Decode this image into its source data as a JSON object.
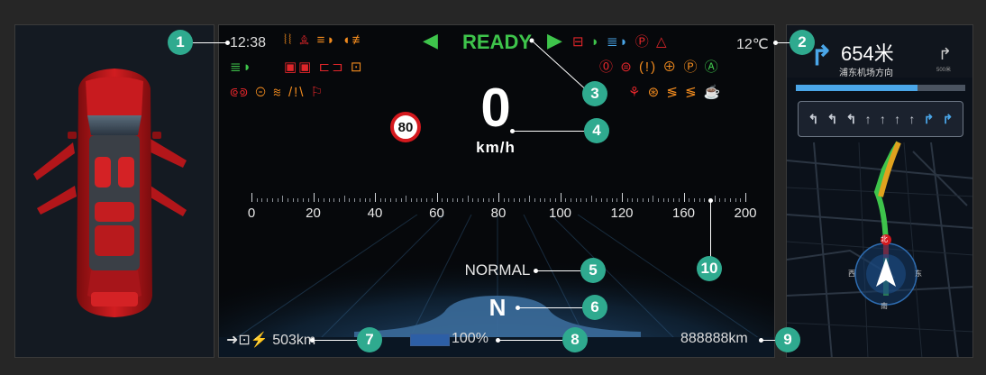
{
  "status_bar": {
    "time": "12:38",
    "ready": "READY",
    "temperature": "12℃"
  },
  "speed": {
    "value": "0",
    "unit": "km/h",
    "limit": "80",
    "scale": [
      "0",
      "20",
      "40",
      "60",
      "80",
      "100",
      "120",
      "160",
      "200"
    ]
  },
  "drive": {
    "mode": "NORMAL",
    "gear": "N"
  },
  "bottom": {
    "range": "503km",
    "battery": "100%",
    "battery_level": 1.0,
    "odometer": "888888km"
  },
  "navigation": {
    "distance": "654米",
    "direction": "浦东机场方向",
    "next_distance": "500米",
    "progress": 0.72,
    "compass": {
      "north": "北",
      "south": "南",
      "east": "东",
      "west": "西"
    }
  },
  "callouts": [
    "1",
    "2",
    "3",
    "4",
    "5",
    "6",
    "7",
    "8",
    "9",
    "10"
  ],
  "colors": {
    "accent_badge": "#2faa8f",
    "ready_green": "#3ec44b",
    "warning_amber": "#f08a1e",
    "warning_red": "#e0262a",
    "nav_blue": "#4aa6e8"
  }
}
